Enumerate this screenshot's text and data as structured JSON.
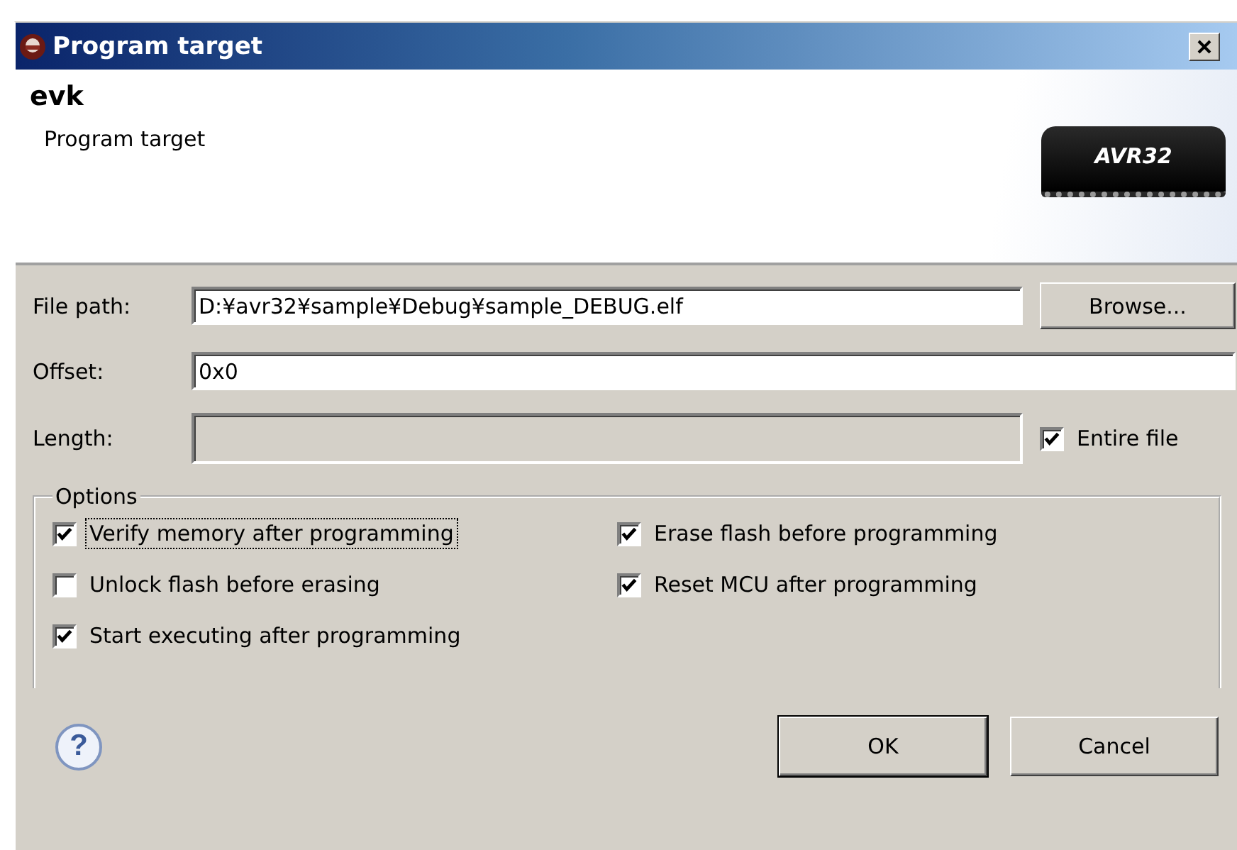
{
  "window": {
    "title": "Program target"
  },
  "header": {
    "title": "evk",
    "subtitle": "Program target",
    "logo_text": "AVR32"
  },
  "fields": [
    {
      "kind": "text",
      "label": "File path:",
      "value": "D:¥avr32¥sample¥Debug¥sample_DEBUG.elf",
      "disabled": false,
      "button": "Browse..."
    },
    {
      "kind": "text",
      "label": "Offset:",
      "value": "0x0",
      "disabled": false
    },
    {
      "kind": "text",
      "label": "Length:",
      "disabled": true,
      "checkbox": {
        "label": "Entire file",
        "checked": true
      }
    }
  ],
  "options": {
    "title": "Options",
    "items": [
      {
        "label": "Verify memory after programming",
        "checked": true,
        "focused": true
      },
      {
        "label": "Erase flash before programming",
        "checked": true,
        "focused": false
      },
      {
        "label": "Unlock flash before erasing",
        "checked": false,
        "focused": false
      },
      {
        "label": "Reset MCU after programming",
        "checked": true,
        "focused": false
      },
      {
        "label": "Start executing after programming",
        "checked": true,
        "focused": false
      }
    ]
  },
  "help": "?",
  "buttons": [
    {
      "label": "OK",
      "default": true
    },
    {
      "label": "Cancel",
      "default": false
    }
  ]
}
